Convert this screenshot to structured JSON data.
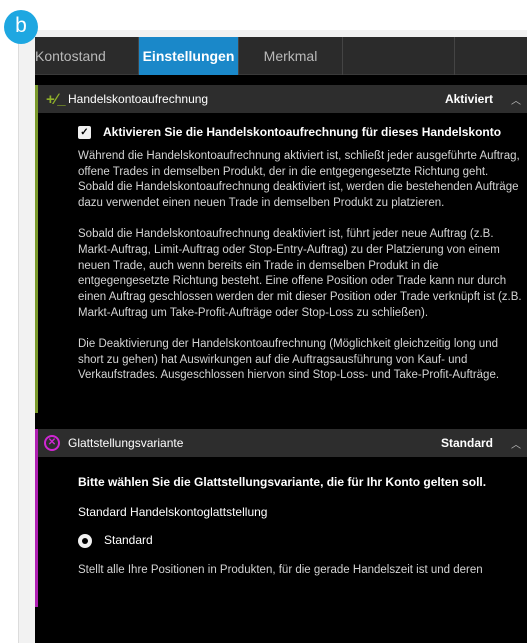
{
  "badge": {
    "letter": "b"
  },
  "tabs": [
    {
      "label": "Kontostand",
      "active": false
    },
    {
      "label": "Einstellungen",
      "active": true
    },
    {
      "label": "Merkmal",
      "active": false
    },
    {
      "label": "",
      "active": false
    },
    {
      "label": "",
      "active": false
    }
  ],
  "colors": {
    "active_tab": "#1a88c9",
    "section1_accent": "#7a9a2c",
    "section2_accent": "#b021b3",
    "badge": "#1ea7e1"
  },
  "section1": {
    "icon": "plus-minus-icon",
    "title": "Handelskontoaufrechnung",
    "status": "Aktiviert",
    "checkbox_label": "Aktivieren Sie die Handelskontoaufrechnung für dieses Handelskonto",
    "checkbox_checked": true,
    "paragraphs": [
      "Während die Handelskontoaufrechnung aktiviert ist, schließt jeder ausgeführte Auftrag, offene Trades in demselben Produkt, der in die entgegengesetzte Richtung geht. Sobald die Handelskontoaufrechnung deaktiviert ist, werden die bestehenden Aufträge dazu verwendet einen neuen Trade in demselben Produkt zu platzieren.",
      "Sobald die Handelskontoaufrechnung deaktiviert ist, führt jeder neue Auftrag (z.B. Markt-Auftrag, Limit-Auftrag oder Stop-Entry-Auftrag) zu der Platzierung von einem neuen Trade, auch wenn bereits ein Trade in demselben Produkt in die entgegengesetzte Richtung besteht. Eine offene Position oder Trade kann nur durch einen Auftrag geschlossen werden der mit dieser Position oder Trade verknüpft ist (z.B. Markt-Auftrag um Take-Profit-Aufträge oder Stop-Loss zu schließen).",
      "Die Deaktivierung der Handelskontoaufrechnung (Möglichkeit gleichzeitig long und short zu gehen) hat Auswirkungen auf die Auftragsausführung von Kauf- und Verkaufstrades. Ausgeschlossen hiervon sind Stop-Loss- und Take-Profit-Aufträge."
    ]
  },
  "section2": {
    "icon": "close-circle-icon",
    "title": "Glattstellungsvariante",
    "status": "Standard",
    "prompt": "Bitte wählen Sie die Glattstellungsvariante, die für Ihr Konto gelten soll.",
    "subheading": "Standard Handelskontoglattstellung",
    "radio_label": "Standard",
    "radio_selected": true,
    "description": "Stellt alle Ihre Positionen in Produkten, für die gerade Handelszeit ist und deren"
  }
}
